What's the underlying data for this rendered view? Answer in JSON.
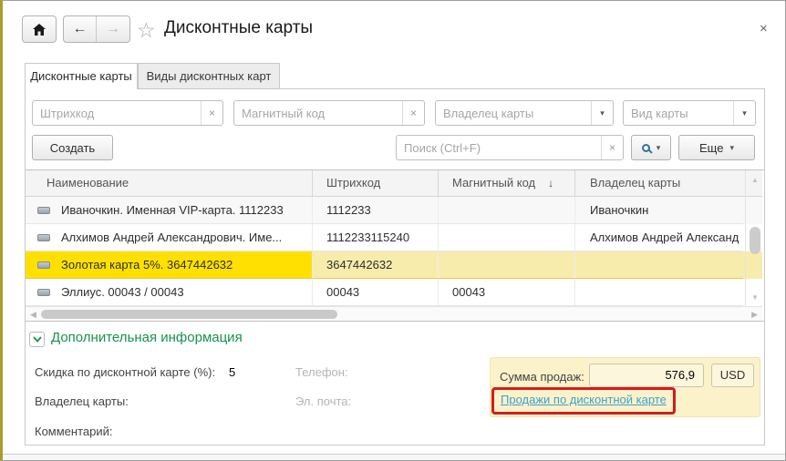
{
  "window": {
    "title": "Дисконтные карты"
  },
  "icons": {
    "back_arrow": "←",
    "forward_arrow": "→",
    "star": "☆",
    "close": "×",
    "clear": "×",
    "combo_arrow": "▾",
    "more_arrow": "▾",
    "mag_arrow": "▾",
    "sort_desc": "↓",
    "scroll_up": "▲",
    "scroll_down": "▼",
    "scroll_left": "◀",
    "scroll_right": "▶"
  },
  "tabs": [
    {
      "label": "Дисконтные карты",
      "active": true
    },
    {
      "label": "Виды дисконтных карт",
      "active": false
    }
  ],
  "filters": {
    "barcode_placeholder": "Штрихкод",
    "magnetic_placeholder": "Магнитный код",
    "owner_placeholder": "Владелец карты",
    "card_type_placeholder": "Вид карты"
  },
  "commands": {
    "create_label": "Создать",
    "search_placeholder": "Поиск (Ctrl+F)",
    "more_label": "Еще"
  },
  "table": {
    "columns": [
      "Наименование",
      "Штрихкод",
      "Магнитный код",
      "Владелец карты"
    ],
    "sorted_column": "Магнитный код",
    "rows": [
      {
        "name": "Иваночкин. Именная VIP-карта. 1112233",
        "barcode": "1112233",
        "magnetic": "",
        "owner": "Иваночкин",
        "selected": false
      },
      {
        "name": "Алхимов Андрей Александрович. Име...",
        "barcode": "1112233115240",
        "magnetic": "",
        "owner": "Алхимов Андрей Александ",
        "selected": false
      },
      {
        "name": "Золотая карта 5%. 3647442632",
        "barcode": "3647442632",
        "magnetic": "",
        "owner": "",
        "selected": true
      },
      {
        "name": "Эллиус. 00043 / 00043",
        "barcode": "00043",
        "magnetic": "00043",
        "owner": "",
        "selected": false
      }
    ]
  },
  "additional_info": {
    "title": "Дополнительная информация",
    "discount_label": "Скидка по дисконтной карте (%):",
    "discount_value": "5",
    "phone_label": "Телефон:",
    "owner_label": "Владелец карты:",
    "email_label": "Эл. почта:",
    "comment_label": "Комментарий:",
    "sales_sum_label": "Сумма продаж:",
    "sales_sum_value": "576,9",
    "currency": "USD",
    "sales_link_label": "Продажи по дисконтной карте"
  },
  "colors": {
    "selected_cell": "#FFE000",
    "selected_row": "#F8ECAC",
    "link": "#3FA0D1",
    "group_title": "#17934D",
    "annotation_red": "#D41C1C",
    "info_panel": "#FBF2CA",
    "window_left_edge": "#AA9C2F"
  }
}
